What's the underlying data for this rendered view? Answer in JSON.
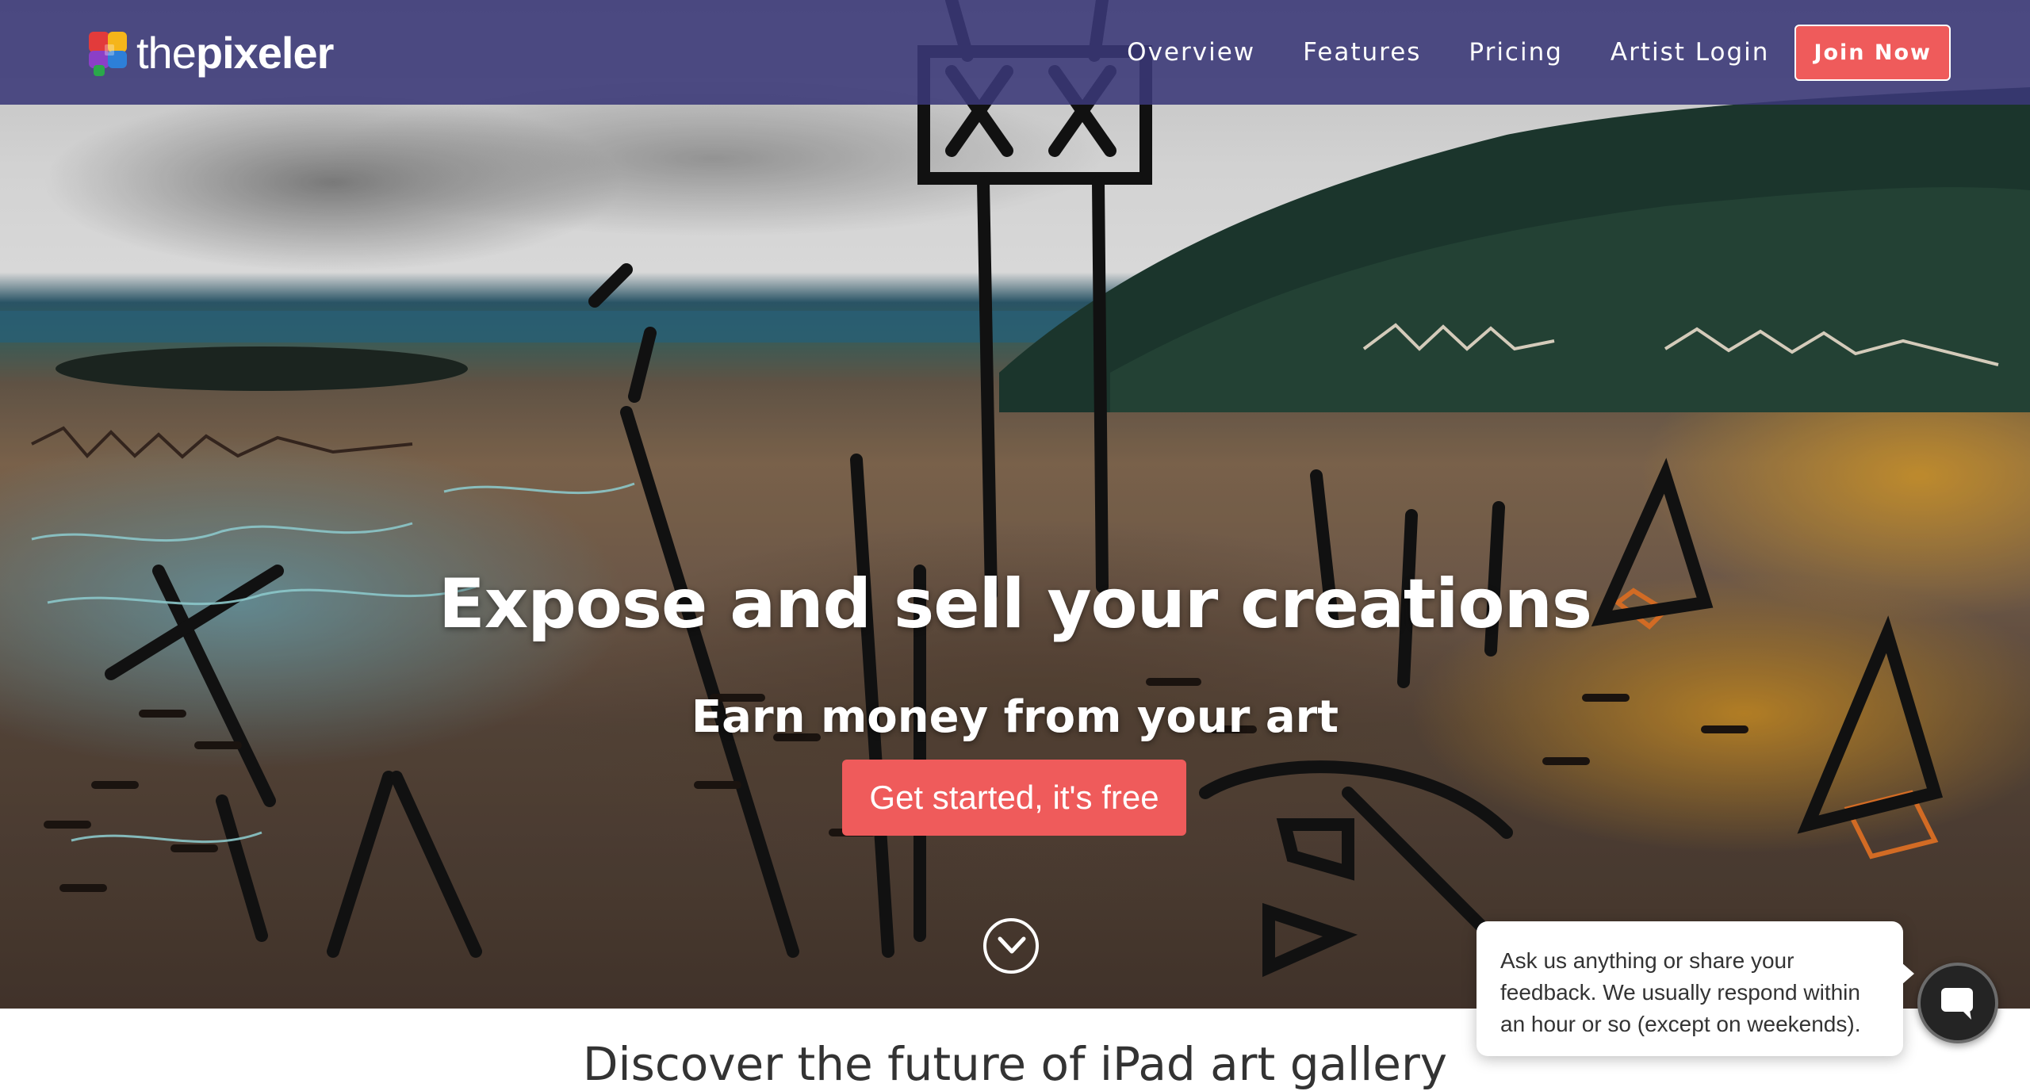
{
  "brand": {
    "name_light": "the",
    "name_bold": "pixeler",
    "logo_colors": [
      "#e23b3b",
      "#f5b51a",
      "#2aa84a",
      "#2d7fd8",
      "#8b3fc7"
    ]
  },
  "nav": {
    "links": [
      "Overview",
      "Features",
      "Pricing",
      "Artist Login"
    ],
    "join_label": "Join Now",
    "background": "#3a3878",
    "accent": "#ef5b5b"
  },
  "hero": {
    "title": "Expose and sell your creations",
    "subtitle": "Earn money from your art",
    "cta_label": "Get started, it's free",
    "scroll_icon": "chevron-down-circle-icon"
  },
  "section": {
    "title": "Discover the future of iPad art gallery"
  },
  "chat": {
    "message": "Ask us anything or share your feedback. We usually respond within an hour or so (except on weekends).",
    "launcher_icon": "chat-bubble-icon"
  }
}
